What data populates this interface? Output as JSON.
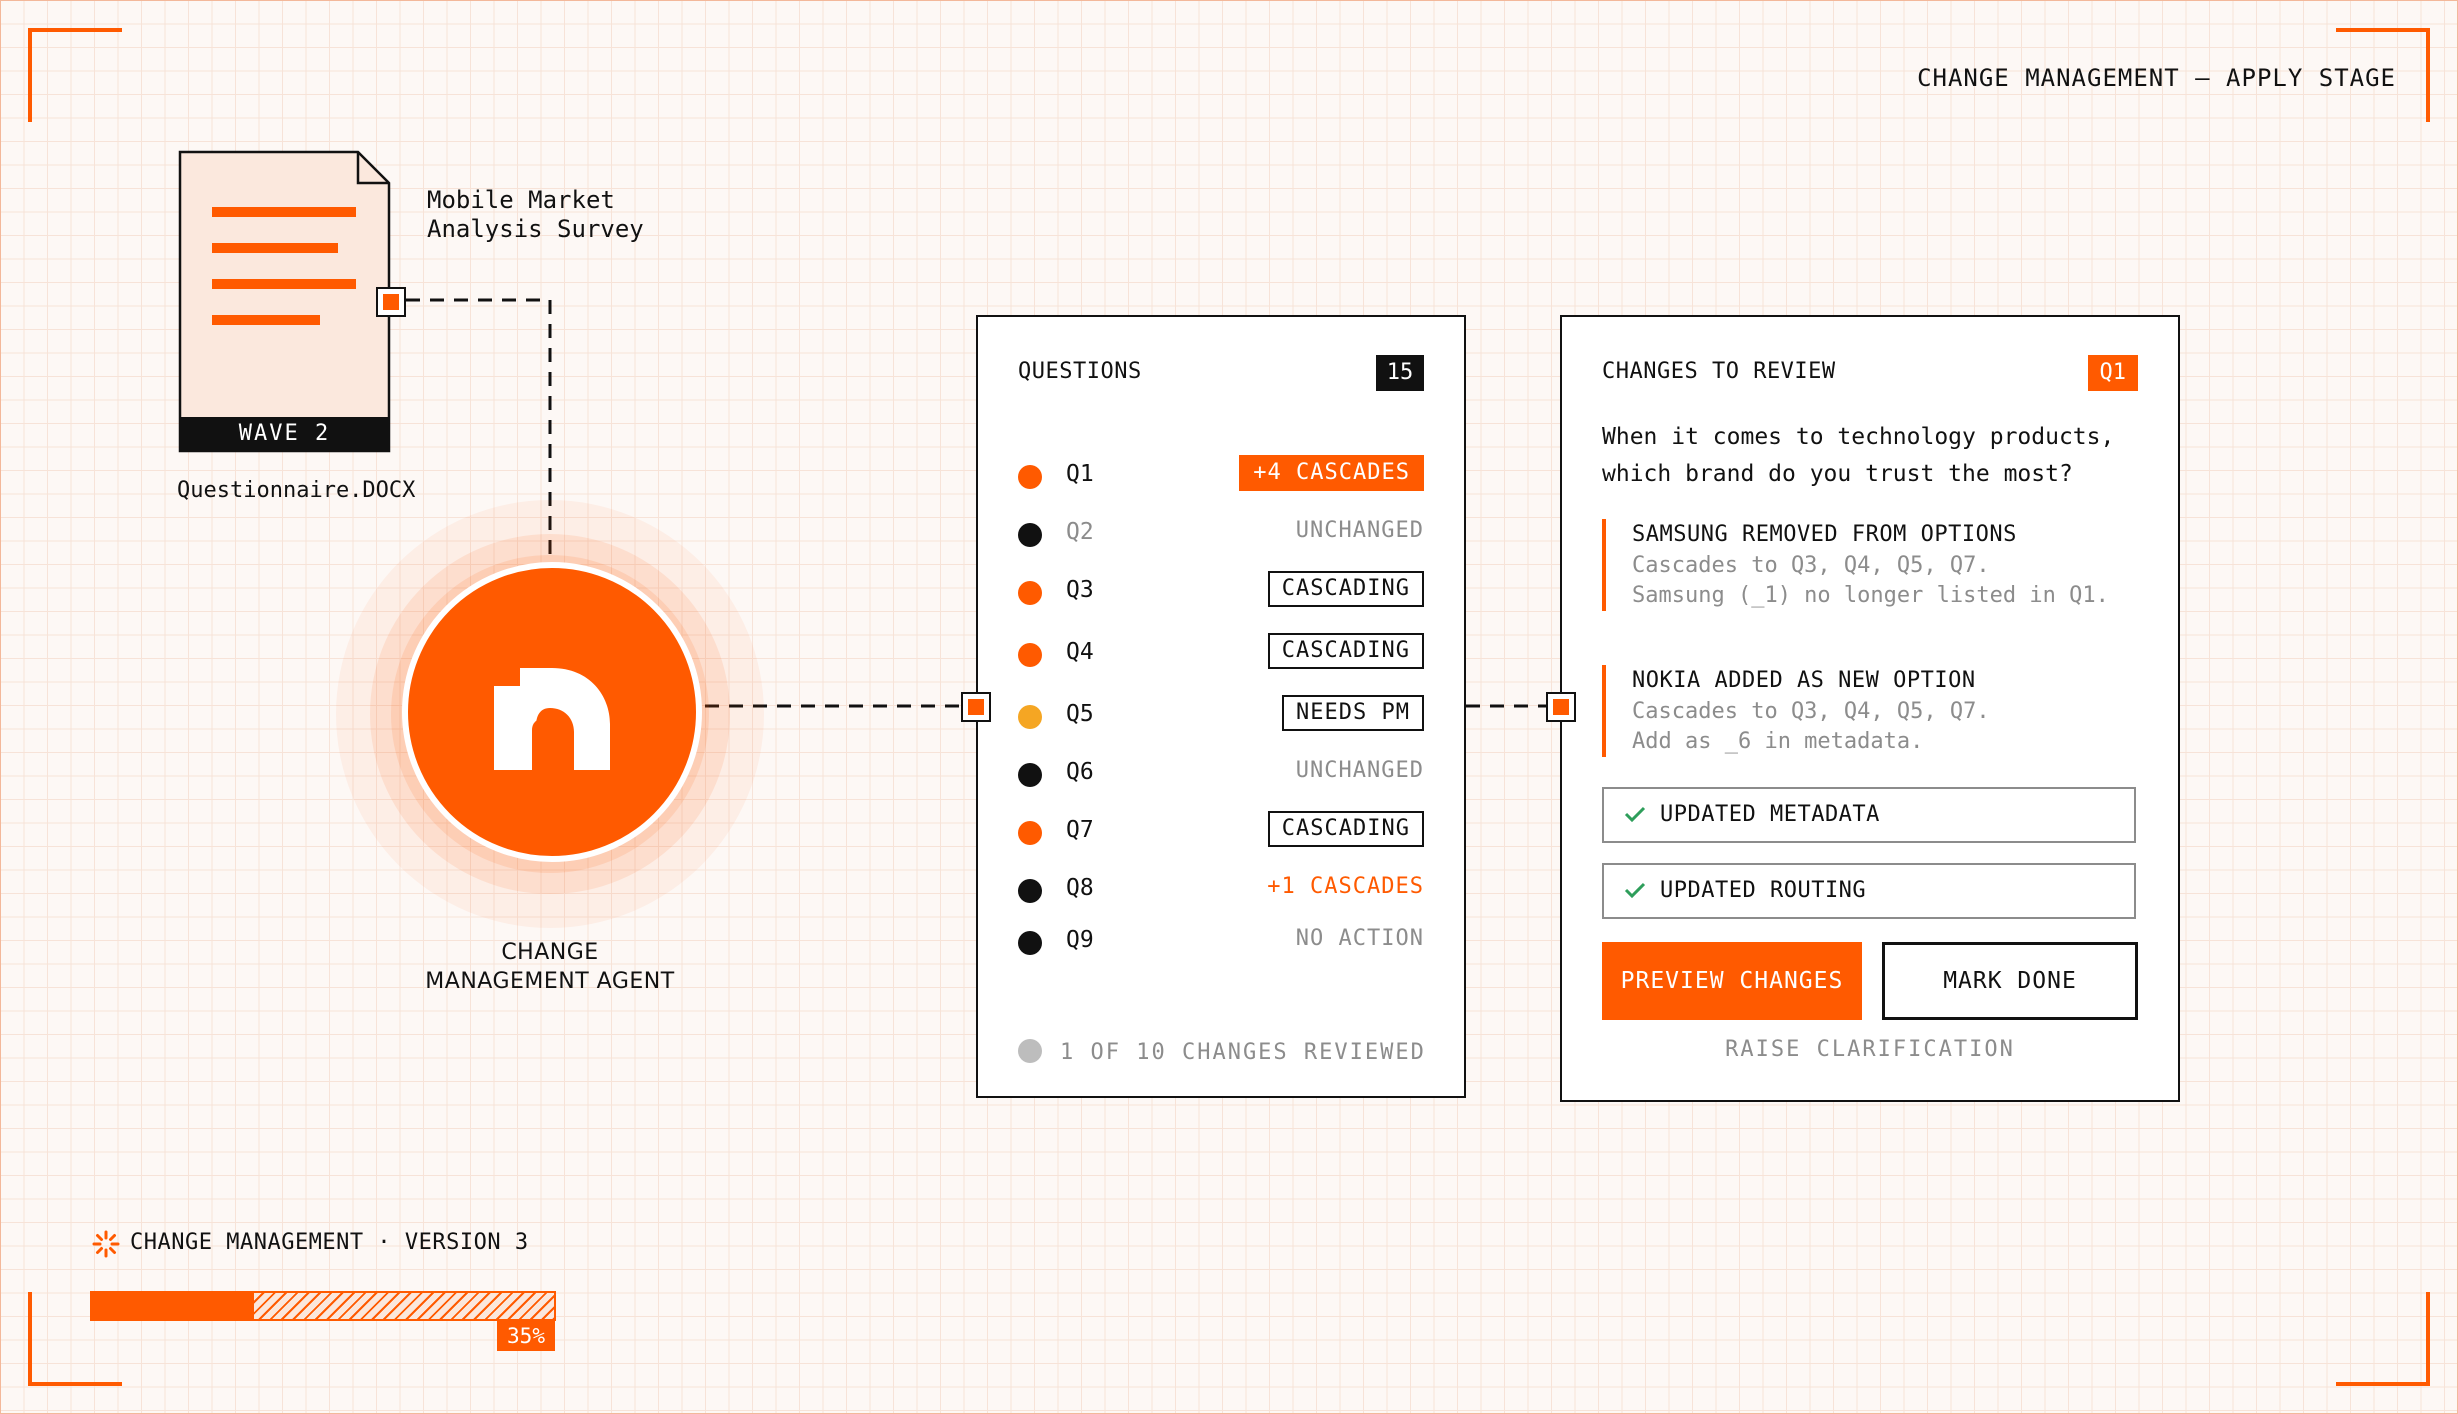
{
  "header": {
    "stage_title": "CHANGE MANAGEMENT — APPLY STAGE"
  },
  "document": {
    "title": "Mobile Market\nAnalysis Survey",
    "wave": "WAVE 2",
    "filename": "Questionnaire.DOCX"
  },
  "agent": {
    "name": "CHANGE MANAGEMENT AGENT",
    "icon": "agent-logo-icon"
  },
  "questions_panel": {
    "title": "QUESTIONS",
    "count": "15",
    "rows": [
      {
        "id": "Q1",
        "dot": "#ff5a00",
        "status": "+4 CASCADES",
        "style": "filled",
        "dim": false
      },
      {
        "id": "Q2",
        "dot": "#111111",
        "status": "UNCHANGED",
        "style": "plain",
        "dim": true
      },
      {
        "id": "Q3",
        "dot": "#ff5a00",
        "status": "CASCADING",
        "style": "boxed",
        "dim": false
      },
      {
        "id": "Q4",
        "dot": "#ff5a00",
        "status": "CASCADING",
        "style": "boxed",
        "dim": false
      },
      {
        "id": "Q5",
        "dot": "#f5a623",
        "status": "NEEDS PM",
        "style": "boxed",
        "dim": false
      },
      {
        "id": "Q6",
        "dot": "#111111",
        "status": "UNCHANGED",
        "style": "plain",
        "dim": false
      },
      {
        "id": "Q7",
        "dot": "#ff5a00",
        "status": "CASCADING",
        "style": "boxed",
        "dim": false
      },
      {
        "id": "Q8",
        "dot": "#111111",
        "status": "+1 CASCADES",
        "style": "orange",
        "dim": false
      },
      {
        "id": "Q9",
        "dot": "#111111",
        "status": "NO ACTION",
        "style": "plain",
        "dim": false
      }
    ],
    "footer": "1 OF 10 CHANGES REVIEWED"
  },
  "review_panel": {
    "title": "CHANGES TO REVIEW",
    "badge": "Q1",
    "question": "When it comes to technology products, which brand do you trust the most?",
    "changes": [
      {
        "heading": "SAMSUNG REMOVED FROM OPTIONS",
        "line1": "Cascades to Q3, Q4, Q5, Q7.",
        "line2": "Samsung (_1) no longer listed in Q1."
      },
      {
        "heading": "NOKIA ADDED AS NEW OPTION",
        "line1": "Cascades to Q3, Q4, Q5, Q7.",
        "line2": "Add as _6 in metadata."
      }
    ],
    "checks": [
      "UPDATED METADATA",
      "UPDATED ROUTING"
    ],
    "preview_button": "PREVIEW CHANGES",
    "done_button": "MARK DONE",
    "clarify_link": "RAISE CLARIFICATION"
  },
  "footer": {
    "label": "CHANGE MANAGEMENT · VERSION 3",
    "progress": 0.35,
    "progress_label": "35%"
  },
  "colors": {
    "accent": "#ff5a00",
    "ink": "#111111",
    "muted": "#8c8c8c",
    "warning": "#f5a623"
  }
}
